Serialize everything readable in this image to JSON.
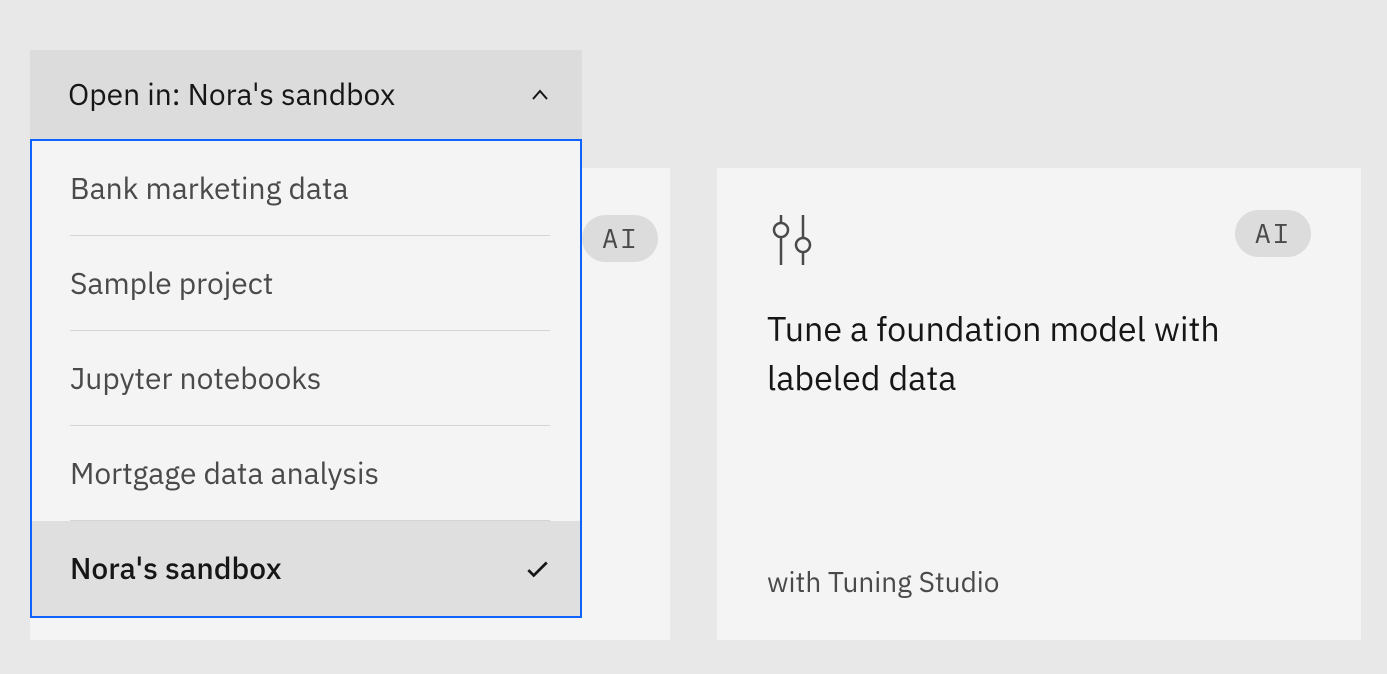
{
  "dropdown": {
    "label_prefix": "Open in: ",
    "selected_value": "Nora's sandbox",
    "full_label": "Open in: Nora's sandbox",
    "items": [
      {
        "label": "Bank marketing data",
        "selected": false
      },
      {
        "label": "Sample project",
        "selected": false
      },
      {
        "label": "Jupyter notebooks",
        "selected": false
      },
      {
        "label": "Mortgage data analysis",
        "selected": false
      },
      {
        "label": "Nora's sandbox",
        "selected": true
      }
    ]
  },
  "behind_card": {
    "badge": "AI"
  },
  "card": {
    "badge": "AI",
    "title": "Tune a foundation model with labeled data",
    "footer": "with Tuning Studio"
  }
}
